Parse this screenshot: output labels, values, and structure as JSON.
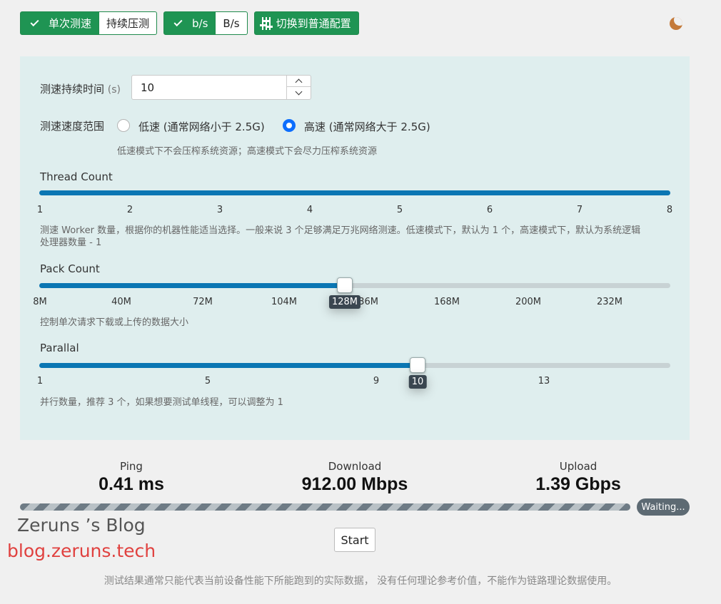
{
  "toolbar": {
    "mode_single": "单次测速",
    "mode_sustained": "持续压测",
    "unit_bits": "b/s",
    "unit_bytes": "B/s",
    "switch_config": "切换到普通配置"
  },
  "settings": {
    "duration_label": "测速持续时间",
    "duration_unit": "(s)",
    "duration_value": "10",
    "range_label": "测速速度范围",
    "range_low": "低速 (通常网络小于 2.5G)",
    "range_high": "高速 (通常网络大于 2.5G)",
    "range_selected": "high",
    "range_help": "低速模式下不会压榨系统资源；高速模式下会尽力压榨系统资源"
  },
  "thread_count": {
    "label": "Thread Count",
    "ticks": [
      "1",
      "2",
      "3",
      "4",
      "5",
      "6",
      "7",
      "8"
    ],
    "value": 8,
    "min": 1,
    "max": 8,
    "help_line1": "测速 Worker 数量，根据你的机器性能适当选择。一般来说 3 个足够满足万兆网络测速。低速模式下，默认为 1 个，高速模式下，默认为系统逻辑",
    "help_line2": "处理器数量 - 1"
  },
  "pack_count": {
    "label": "Pack Count",
    "ticks": [
      "8M",
      "40M",
      "72M",
      "104M",
      "136M",
      "168M",
      "200M",
      "232M"
    ],
    "value_label": "128M",
    "value": 128,
    "min": 8,
    "max": 256,
    "help": "控制单次请求下载或上传的数据大小"
  },
  "parallel": {
    "label": "Parallal",
    "ticks": [
      "1",
      "5",
      "9",
      "13"
    ],
    "value_label": "10",
    "value": 10,
    "min": 1,
    "max": 15,
    "help": "并行数量，推荐 3 个，如果想要测试单线程，可以调整为 1"
  },
  "results": {
    "ping_label": "Ping",
    "ping_value": "0.41 ms",
    "download_label": "Download",
    "download_value": "912.00 Mbps",
    "upload_label": "Upload",
    "upload_value": "1.39 Gbps"
  },
  "status": {
    "badge": "Waiting..."
  },
  "watermark": {
    "line1": "Zeruns ’s Blog",
    "line2": "blog.zeruns.tech"
  },
  "actions": {
    "start": "Start"
  },
  "footer": {
    "disclaimer": "测试结果通常只能代表当前设备性能下所能跑到的实际数据， 没有任何理论参考价值，不能作为链路理论数据使用。"
  },
  "colors": {
    "accent_green": "#1f9453",
    "slider_blue": "#0b76b3",
    "panel_bg": "#dfeeee",
    "brand_red": "#e0413f",
    "moon": "#c47a3a"
  },
  "icons": {
    "check": "check-icon",
    "sliders": "sliders-icon",
    "theme": "moon-icon"
  }
}
